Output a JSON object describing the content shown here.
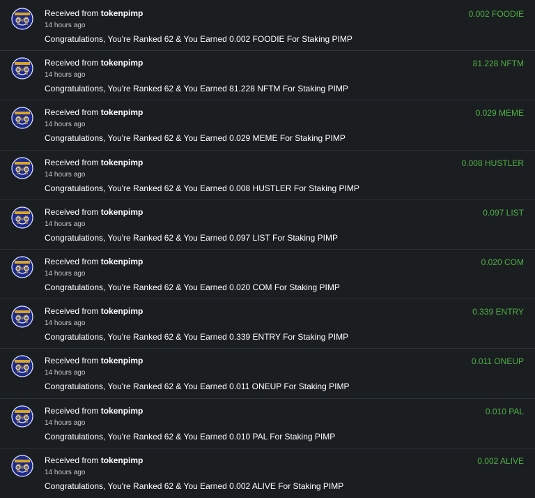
{
  "colors": {
    "background": "#1b1e21",
    "divider": "#2c3136",
    "text_primary": "#ffffff",
    "text_secondary": "#c7cacd",
    "amount_green": "#4fb043",
    "avatar_blue": "#1c2a8c",
    "avatar_gold": "#d9a520"
  },
  "transactions": [
    {
      "prefix": "Received from ",
      "sender": "tokenpimp",
      "time": "14 hours ago",
      "message": "Congratulations, You're Ranked 62 & You Earned 0.002 FOODIE For Staking PIMP",
      "amount": "0.002 FOODIE",
      "avatar_icon": "tokenpimp-avatar-icon"
    },
    {
      "prefix": "Received from ",
      "sender": "tokenpimp",
      "time": "14 hours ago",
      "message": "Congratulations, You're Ranked 62 & You Earned 81.228 NFTM For Staking PIMP",
      "amount": "81.228 NFTM",
      "avatar_icon": "tokenpimp-avatar-icon"
    },
    {
      "prefix": "Received from ",
      "sender": "tokenpimp",
      "time": "14 hours ago",
      "message": "Congratulations, You're Ranked 62 & You Earned 0.029 MEME For Staking PIMP",
      "amount": "0.029 MEME",
      "avatar_icon": "tokenpimp-avatar-icon"
    },
    {
      "prefix": "Received from ",
      "sender": "tokenpimp",
      "time": "14 hours ago",
      "message": "Congratulations, You're Ranked 62 & You Earned 0.008 HUSTLER For Staking PIMP",
      "amount": "0.008 HUSTLER",
      "avatar_icon": "tokenpimp-avatar-icon"
    },
    {
      "prefix": "Received from ",
      "sender": "tokenpimp",
      "time": "14 hours ago",
      "message": "Congratulations, You're Ranked 62 & You Earned 0.097 LIST For Staking PIMP",
      "amount": "0.097 LIST",
      "avatar_icon": "tokenpimp-avatar-icon"
    },
    {
      "prefix": "Received from ",
      "sender": "tokenpimp",
      "time": "14 hours ago",
      "message": "Congratulations, You're Ranked 62 & You Earned 0.020 COM For Staking PIMP",
      "amount": "0.020 COM",
      "avatar_icon": "tokenpimp-avatar-icon"
    },
    {
      "prefix": "Received from ",
      "sender": "tokenpimp",
      "time": "14 hours ago",
      "message": "Congratulations, You're Ranked 62 & You Earned 0.339 ENTRY For Staking PIMP",
      "amount": "0.339 ENTRY",
      "avatar_icon": "tokenpimp-avatar-icon"
    },
    {
      "prefix": "Received from ",
      "sender": "tokenpimp",
      "time": "14 hours ago",
      "message": "Congratulations, You're Ranked 62 & You Earned 0.011 ONEUP For Staking PIMP",
      "amount": "0.011 ONEUP",
      "avatar_icon": "tokenpimp-avatar-icon"
    },
    {
      "prefix": "Received from ",
      "sender": "tokenpimp",
      "time": "14 hours ago",
      "message": "Congratulations, You're Ranked 62 & You Earned 0.010 PAL For Staking PIMP",
      "amount": "0.010 PAL",
      "avatar_icon": "tokenpimp-avatar-icon"
    },
    {
      "prefix": "Received from ",
      "sender": "tokenpimp",
      "time": "14 hours ago",
      "message": "Congratulations, You're Ranked 62 & You Earned 0.002 ALIVE For Staking PIMP",
      "amount": "0.002 ALIVE",
      "avatar_icon": "tokenpimp-avatar-icon"
    }
  ]
}
